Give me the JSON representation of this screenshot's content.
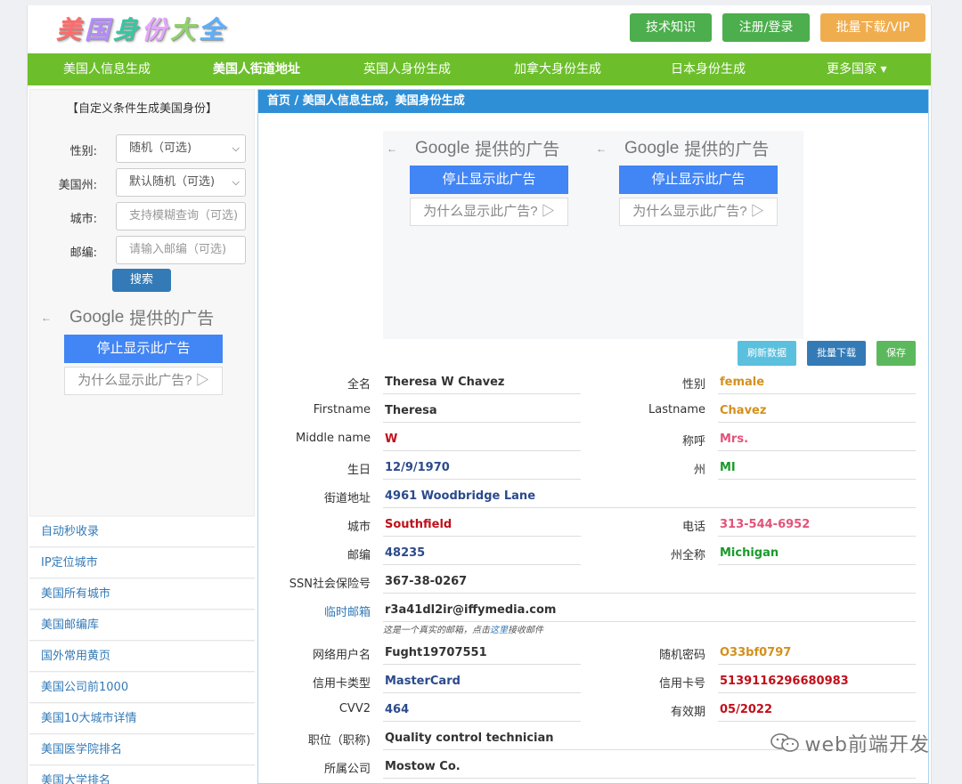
{
  "header": {
    "logo_chars": [
      "美",
      "国",
      "身",
      "份",
      "大",
      "全"
    ],
    "logo_colors": [
      "#ff6b6b",
      "#b58cff",
      "#36c7a0",
      "#e7a6ff",
      "#8fd36b",
      "#59b0ff"
    ],
    "btn_knowledge": "技术知识",
    "btn_login": "注册/登录",
    "btn_vip": "批量下载/VIP"
  },
  "nav": {
    "items": [
      "美国人信息生成",
      "美国人街道地址",
      "英国人身份生成",
      "加拿大身份生成",
      "日本身份生成",
      "更多国家 ▾"
    ]
  },
  "sidebar": {
    "form_title": "【自定义条件生成美国身份】",
    "gender_label": "性别:",
    "gender_value": "随机（可选)",
    "state_label": "美国州:",
    "state_value": "默认随机（可选)",
    "city_label": "城市:",
    "city_placeholder": "支持模糊查询（可选)",
    "zip_label": "邮编:",
    "zip_placeholder": "请输入邮编（可选)",
    "search_button": "搜索",
    "links": [
      "自动秒收录",
      "IP定位城市",
      "美国所有城市",
      "美国邮编库",
      "国外常用黄页",
      "美国公司前1000",
      "美国10大城市详情",
      "美国医学院排名",
      "美国大学排名"
    ]
  },
  "ad": {
    "google": "Google",
    "provided": "提供的广告",
    "stop": "停止显示此广告",
    "why": "为什么显示此广告?"
  },
  "main": {
    "breadcrumb": "首页  /  美国人信息生成，美国身份生成",
    "btn_refresh": "刷新数据",
    "btn_bulk": "批量下载",
    "btn_save": "保存"
  },
  "person": {
    "fullname_label": "全名",
    "fullname": "Theresa W Chavez",
    "gender_label": "性别",
    "gender": "female",
    "firstname_label": "Firstname",
    "firstname": "Theresa",
    "lastname_label": "Lastname",
    "lastname": "Chavez",
    "middle_label": "Middle name",
    "middle": "W",
    "title_label": "称呼",
    "title": "Mrs.",
    "birthday_label": "生日",
    "birthday": "12/9/1970",
    "state_label": "州",
    "state": "MI",
    "street_label": "街道地址",
    "street": "4961 Woodbridge Lane",
    "city_label": "城市",
    "city": "Southfield",
    "phone_label": "电话",
    "phone": "313-544-6952",
    "zip_label": "邮编",
    "zip": "48235",
    "statefull_label": "州全称",
    "statefull": "Michigan",
    "ssn_label": "SSN社会保险号",
    "ssn": "367-38-0267",
    "email_label": "临时邮箱",
    "email": "r3a41dl2ir@iffymedia.com",
    "email_note_pre": "这是一个真实的邮箱，点击",
    "email_note_link": "这里",
    "email_note_post": "接收邮件",
    "username_label": "网络用户名",
    "username": "Fught19707551",
    "password_label": "随机密码",
    "password": "O33bf0797",
    "cctype_label": "信用卡类型",
    "cctype": "MasterCard",
    "ccnum_label": "信用卡号",
    "ccnum": "5139116296680983",
    "cvv_label": "CVV2",
    "cvv": "464",
    "expiry_label": "有效期",
    "expiry": "05/2022",
    "job_label": "职位（职称)",
    "job": "Quality control technician",
    "company_label": "所属公司",
    "company": "Mostow Co."
  },
  "watermark": "web前端开发",
  "colors": {
    "nav_green": "#6cbf2b",
    "crumb_blue": "#2f8fd6",
    "link_blue": "#337ab7",
    "orange": "#d4901c",
    "red": "#c0101a",
    "pink": "#e2537a",
    "green": "#1a9a2a",
    "navy": "#2b4a8c",
    "dark": "#333333"
  }
}
